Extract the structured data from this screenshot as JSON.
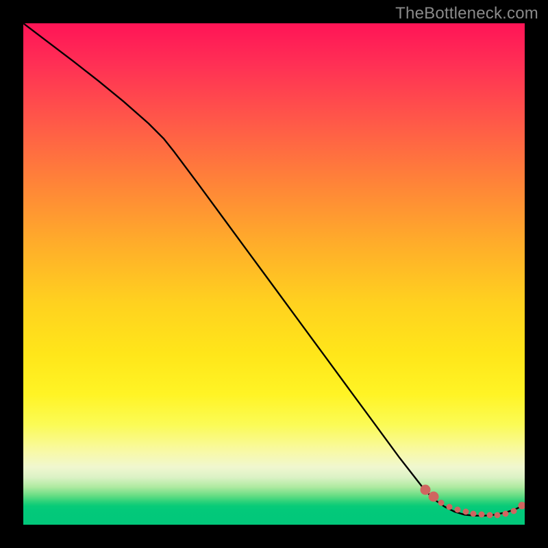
{
  "watermark": "TheBottleneck.com",
  "colors": {
    "curve": "#000000",
    "marker": "#cf6560",
    "background": "#000000"
  },
  "chart_data": {
    "type": "line",
    "title": "",
    "xlabel": "",
    "ylabel": "",
    "xlim": [
      0,
      100
    ],
    "ylim": [
      0,
      100
    ],
    "grid": false,
    "series": [
      {
        "name": "bottleneck-curve",
        "style": "solid",
        "x": [
          0,
          5,
          10,
          15,
          20,
          25,
          28,
          30,
          35,
          40,
          45,
          50,
          55,
          60,
          65,
          70,
          75,
          80,
          82,
          84,
          86,
          88,
          90,
          92,
          94,
          96,
          98,
          100
        ],
        "y": [
          100,
          96.2,
          92.4,
          88.5,
          84.4,
          80.0,
          77.0,
          74.5,
          67.8,
          61.0,
          54.2,
          47.4,
          40.6,
          33.8,
          27.0,
          20.2,
          13.4,
          7.0,
          5.0,
          3.6,
          2.6,
          2.0,
          1.8,
          1.8,
          2.0,
          2.4,
          3.0,
          4.0
        ]
      },
      {
        "name": "bottleneck-floor-dots",
        "style": "dotted",
        "x": [
          80.2,
          81.8,
          83.4,
          85.0,
          86.6,
          88.2,
          89.8,
          91.4,
          93.0,
          94.6,
          96.2,
          97.8,
          99.5
        ],
        "y": [
          7.0,
          5.6,
          4.4,
          3.6,
          3.0,
          2.6,
          2.2,
          2.0,
          1.9,
          1.9,
          2.2,
          2.8,
          3.8
        ]
      }
    ]
  }
}
